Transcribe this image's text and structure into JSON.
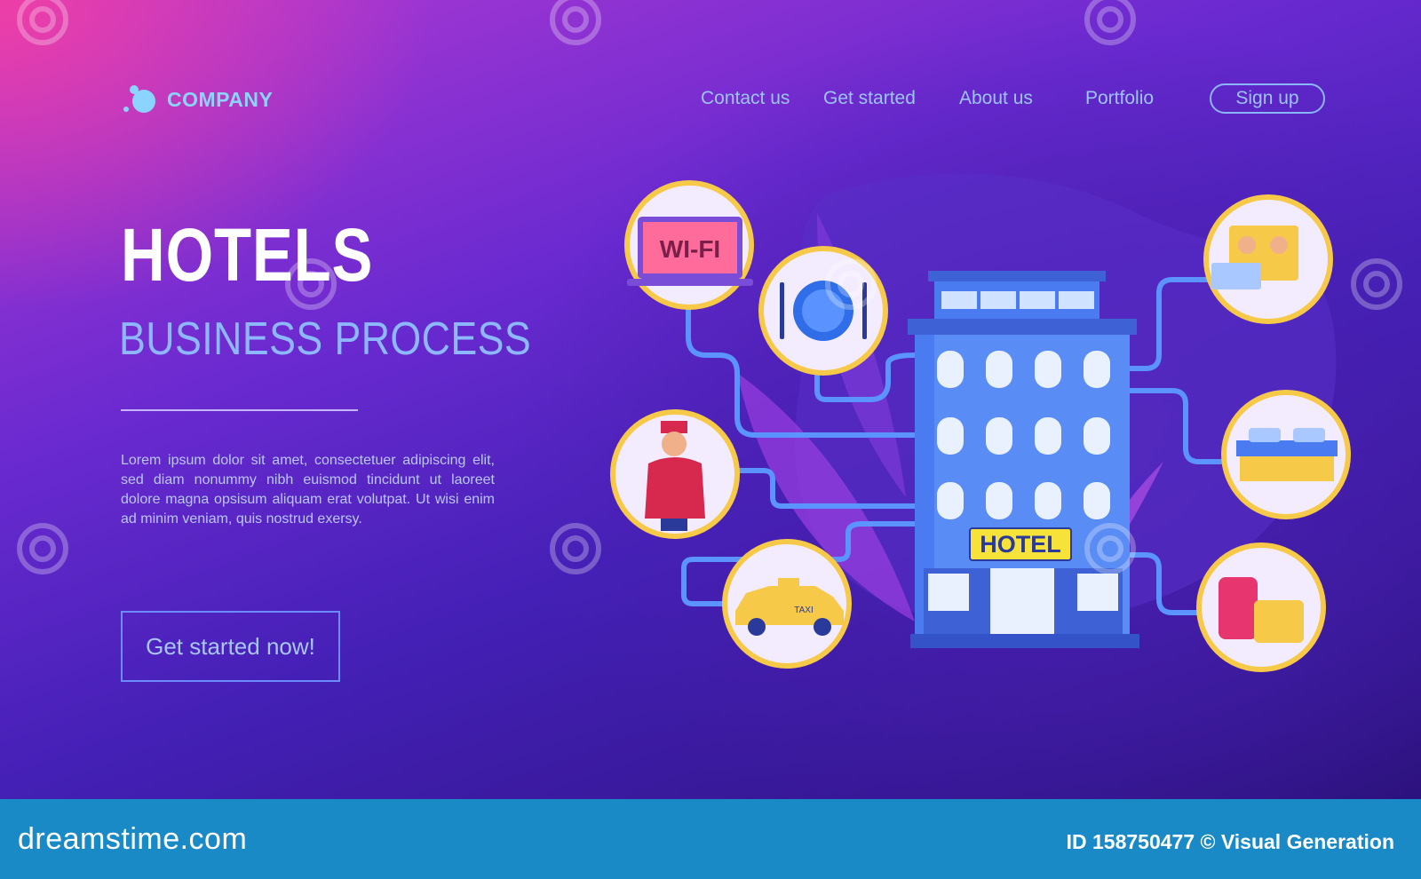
{
  "brand": {
    "name": "COMPANY"
  },
  "nav": {
    "items": [
      {
        "label": "Contact us"
      },
      {
        "label": "Get started"
      },
      {
        "label": "About us"
      },
      {
        "label": "Portfolio"
      }
    ],
    "signup_label": "Sign up"
  },
  "hero": {
    "title": "HOTELS",
    "subtitle": "BUSINESS PROCESS",
    "description": "Lorem ipsum dolor sit amet, consectetuer adipiscing elit, sed diam nonummy nibh euismod tincidunt ut laoreet dolore magna opsisum aliquam erat volutpat. Ut wisi enim ad minim veniam, quis nostrud exersy.",
    "cta_label": "Get started now!"
  },
  "illustration": {
    "building_sign": "HOTEL",
    "wifi_label": "WI-FI",
    "taxi_label": "TAXI",
    "services": [
      {
        "icon": "wifi-laptop-icon"
      },
      {
        "icon": "dining-plate-icon"
      },
      {
        "icon": "bellboy-icon"
      },
      {
        "icon": "taxi-icon"
      },
      {
        "icon": "passport-key-icon"
      },
      {
        "icon": "bed-icon"
      },
      {
        "icon": "luggage-icon"
      }
    ]
  },
  "watermark": {
    "text": "dreamstime"
  },
  "footer": {
    "logo_text": "dreamstime.com",
    "id_text": "ID 158750477 © Visual Generation"
  },
  "colors": {
    "nav_text": "#9cc4ff",
    "brand": "#8bd4ff",
    "footer": "#1a8ac7",
    "building": "#4a7bf0",
    "taxi": "#f7c948"
  }
}
